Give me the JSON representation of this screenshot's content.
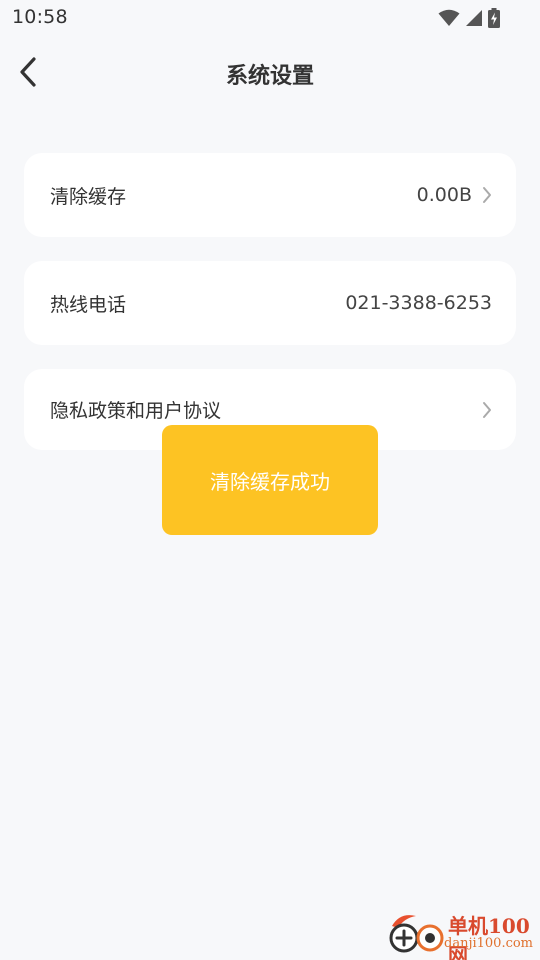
{
  "status_bar": {
    "time": "10:58",
    "icons": [
      "wifi-icon",
      "signal-icon",
      "battery-charging-icon"
    ]
  },
  "header": {
    "title": "系统设置",
    "back_icon": "chevron-left-icon"
  },
  "settings": {
    "items": [
      {
        "label": "清除缓存",
        "value": "0.00B",
        "has_chevron": true
      },
      {
        "label": "热线电话",
        "value": "021-3388-6253",
        "has_chevron": false
      },
      {
        "label": "隐私政策和用户协议",
        "value": "",
        "has_chevron": true
      }
    ]
  },
  "toast": {
    "message": "清除缓存成功",
    "color": "#fdc323"
  },
  "watermark": {
    "title": "单机100网",
    "url": "danji100.com"
  },
  "colors": {
    "background": "#f7f8fa",
    "card": "#ffffff",
    "text": "#333333",
    "accent": "#fdc323"
  }
}
